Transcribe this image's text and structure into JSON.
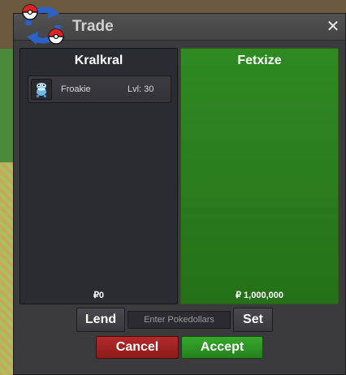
{
  "window": {
    "title": "Trade",
    "close_label": "✕"
  },
  "left_panel": {
    "player_name": "Kralkral",
    "money": "₽0",
    "items": [
      {
        "name": "Froakie",
        "level": "Lvl: 30",
        "icon": "froakie-sprite-icon"
      }
    ]
  },
  "right_panel": {
    "player_name": "Fetxize",
    "money": "₽ 1,000,000"
  },
  "controls": {
    "lend_label": "Lend",
    "money_placeholder": "Enter Pokedollars",
    "set_label": "Set",
    "cancel_label": "Cancel",
    "accept_label": "Accept"
  },
  "colors": {
    "accept_green": "#2f8a22",
    "cancel_red": "#9e2222",
    "window_bg": "#3b3b3d"
  }
}
